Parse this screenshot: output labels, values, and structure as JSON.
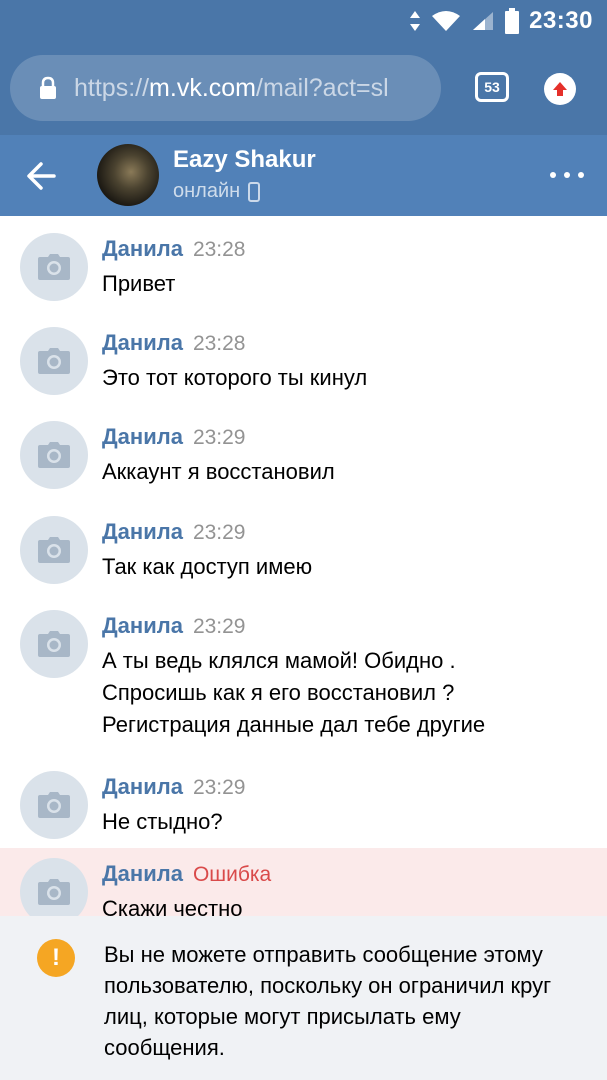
{
  "status_bar": {
    "time": "23:30"
  },
  "browser": {
    "url_prefix": "https://",
    "url_host": "m.vk.com",
    "url_path": "/mail?act=sl",
    "tab_count": "53"
  },
  "chat": {
    "name": "Eazy Shakur",
    "status": "онлайн"
  },
  "messages": [
    {
      "author": "Данила",
      "time": "23:28",
      "text": [
        "Привет"
      ]
    },
    {
      "author": "Данила",
      "time": "23:28",
      "text": [
        "Это тот которого ты кинул"
      ]
    },
    {
      "author": "Данила",
      "time": "23:29",
      "text": [
        "Аккаунт я восстановил"
      ]
    },
    {
      "author": "Данила",
      "time": "23:29",
      "text": [
        "Так как доступ имею"
      ]
    },
    {
      "author": "Данила",
      "time": "23:29",
      "text": [
        "А ты ведь клялся мамой! Обидно .",
        "Спросишь как я его восстановил ?",
        "Регистрация данные дал тебе другие"
      ]
    },
    {
      "author": "Данила",
      "time": "23:29",
      "text": [
        "Не стыдно?"
      ]
    },
    {
      "author": "Данила",
      "time": "Ошибка",
      "text": [
        "Скажи честно"
      ],
      "error": true
    }
  ],
  "notice": {
    "text": "Вы не можете отправить сообщение этому пользователю, поскольку он ограничил круг лиц, которые могут присылать ему сообщения."
  },
  "colors": {
    "header": "#5181b8",
    "status_bar": "#4a76a8",
    "author": "#4a76a8",
    "error": "#d94a4a",
    "warning": "#f5a623"
  }
}
